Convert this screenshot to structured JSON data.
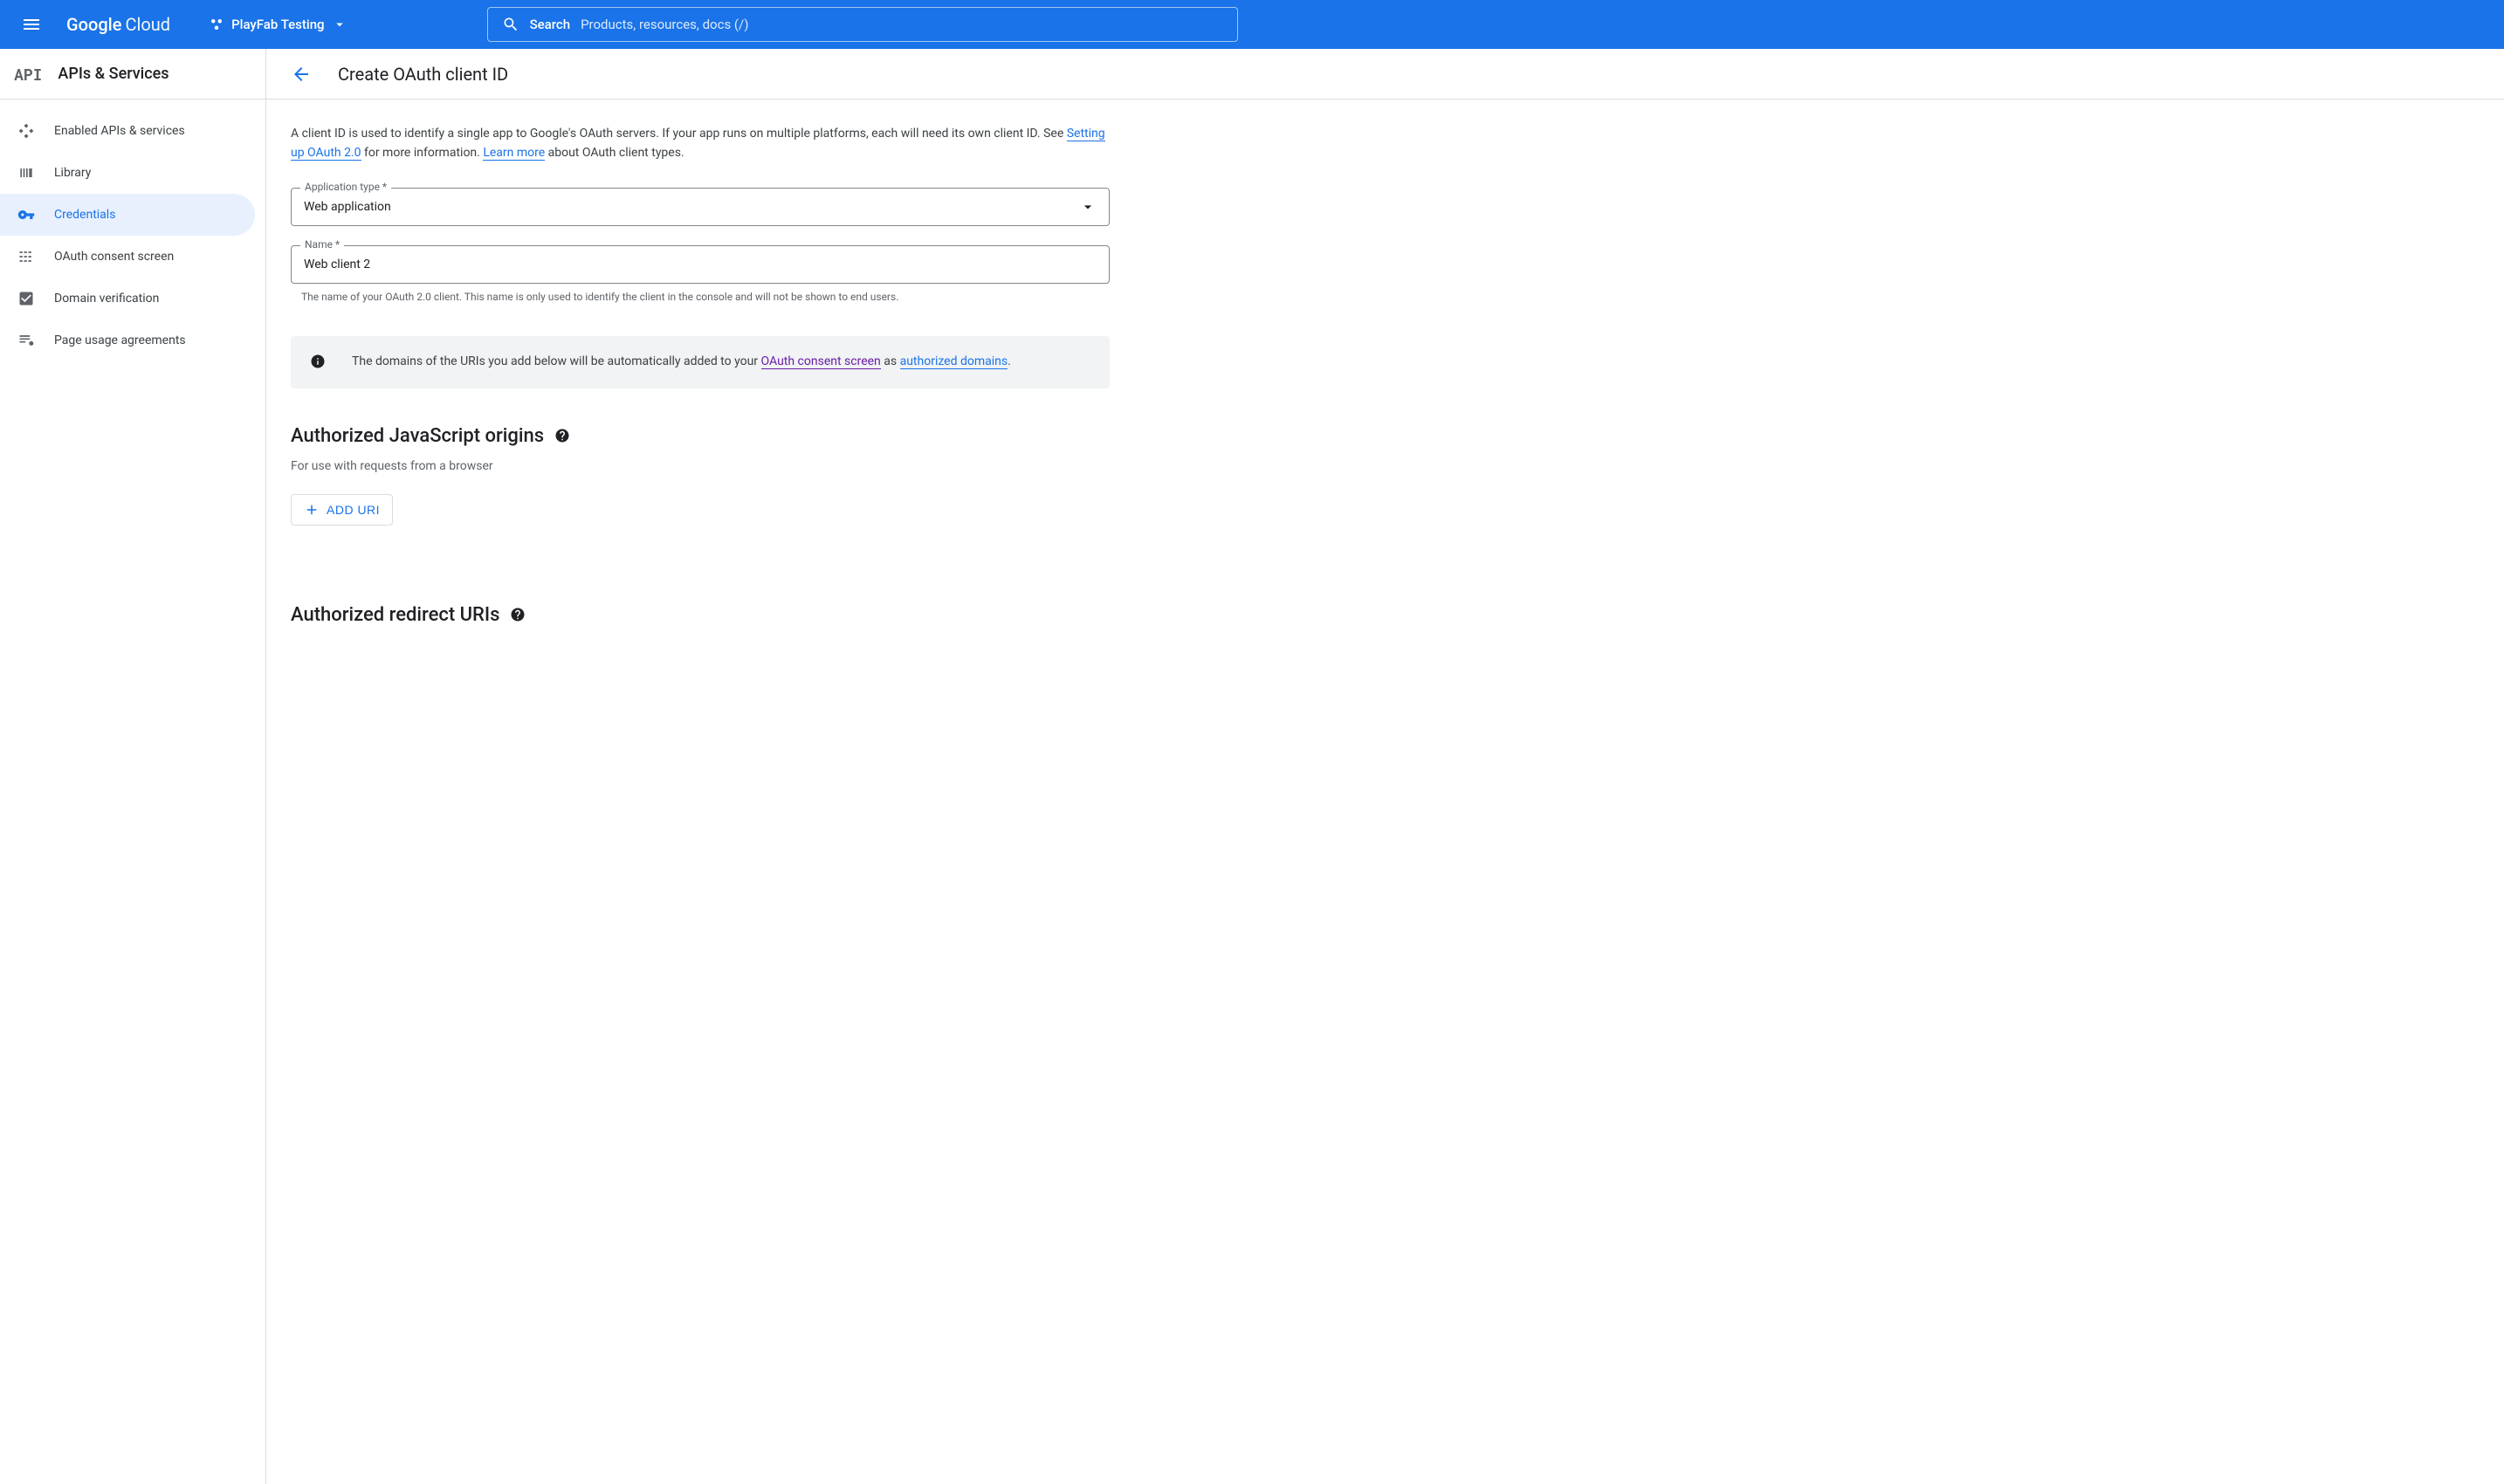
{
  "header": {
    "logo_google": "Google",
    "logo_cloud": "Cloud",
    "project_name": "PlayFab Testing",
    "search_label": "Search",
    "search_placeholder": "Products, resources, docs (/)"
  },
  "sidebar": {
    "api_logo": "API",
    "title": "APIs & Services",
    "items": [
      {
        "label": "Enabled APIs & services"
      },
      {
        "label": "Library"
      },
      {
        "label": "Credentials"
      },
      {
        "label": "OAuth consent screen"
      },
      {
        "label": "Domain verification"
      },
      {
        "label": "Page usage agreements"
      }
    ]
  },
  "main": {
    "title": "Create OAuth client ID",
    "description_pre": "A client ID is used to identify a single app to Google's OAuth servers. If your app runs on multiple platforms, each will need its own client ID. See ",
    "link1": "Setting up OAuth 2.0",
    "description_mid": " for more information. ",
    "link2": "Learn more",
    "description_post": " about OAuth client types.",
    "app_type_label": "Application type *",
    "app_type_value": "Web application",
    "name_label": "Name *",
    "name_value": "Web client 2",
    "name_helper": "The name of your OAuth 2.0 client. This name is only used to identify the client in the console and will not be shown to end users.",
    "info_pre": "The domains of the URIs you add below will be automatically added to your ",
    "info_link1": "OAuth consent screen",
    "info_mid": " as ",
    "info_link2": "authorized domains",
    "info_post": ".",
    "section1_title": "Authorized JavaScript origins",
    "section1_desc": "For use with requests from a browser",
    "add_uri": "ADD URI",
    "section2_title": "Authorized redirect URIs"
  }
}
